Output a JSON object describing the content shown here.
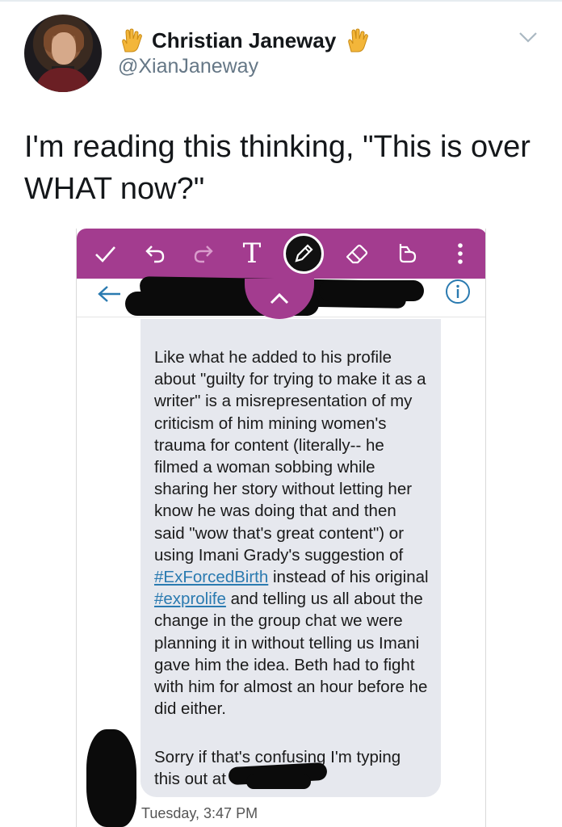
{
  "tweet": {
    "display_name": "Christian Janeway",
    "handle": "@XianJaneway",
    "text": "I'm reading this thinking, \"This is over WHAT now?\"",
    "icons": {
      "name_emoji": "vulcan-salute-icon",
      "menu": "chevron-down-icon"
    }
  },
  "screenshot": {
    "toolbar": {
      "buttons": [
        "check-icon",
        "undo-icon",
        "redo-icon",
        "text-tool",
        "pencil-icon",
        "eraser-icon",
        "crop-icon",
        "more-icon"
      ],
      "text_tool_label": "T",
      "accent": "#a33c8f"
    },
    "message": {
      "part1": "Like what he added to his profile about \"guilty for trying to make it as a writer\" is a misrepresentation of my criticism of him mining women's trauma for content (literally-- he filmed a woman sobbing while sharing her story without letting her know he was doing that and then said \"wow that's great content\") or using Imani Grady's suggestion of ",
      "hashtag1": "#ExForcedBirth",
      "part2": " instead of his original ",
      "hashtag2": "#exprolife",
      "part3": " and telling us all about the change in the group chat we were planning it in without telling us Imani gave him the idea. Beth had to fight with him for almost an hour before he did either.",
      "part4": "Sorry if that's confusing I'm typing this out at"
    },
    "timestamp": "Tuesday, 3:47 PM"
  }
}
